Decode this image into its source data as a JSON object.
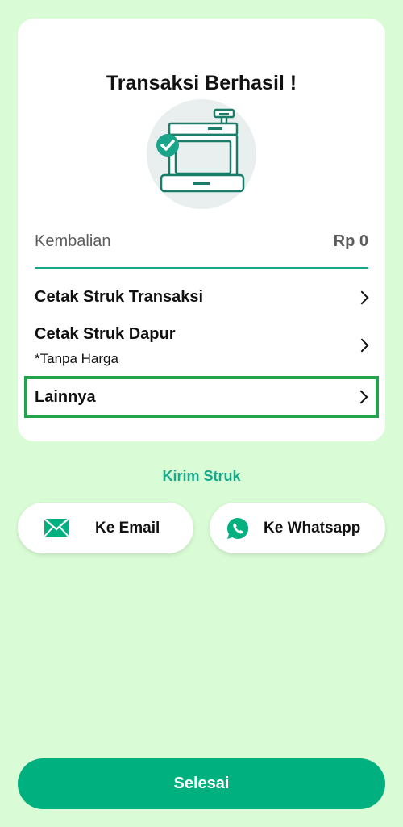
{
  "card": {
    "title": "Transaksi Berhasil !",
    "illustration_icon": "cash-register-success-icon",
    "change": {
      "label": "Kembalian",
      "value": "Rp 0"
    },
    "menu": [
      {
        "label": "Cetak Struk Transaksi",
        "sub": ""
      },
      {
        "label": "Cetak Struk Dapur",
        "sub": "*Tanpa Harga"
      },
      {
        "label": "Lainnya",
        "sub": ""
      }
    ]
  },
  "send": {
    "title": "Kirim Struk",
    "email_label": "Ke Email",
    "whatsapp_label": "Ke Whatsapp"
  },
  "footer": {
    "done_label": "Selesai"
  },
  "colors": {
    "background": "#d9fcd6",
    "accent": "#00b07f",
    "divider": "#1aa58a",
    "highlight_border": "#22a24a"
  }
}
